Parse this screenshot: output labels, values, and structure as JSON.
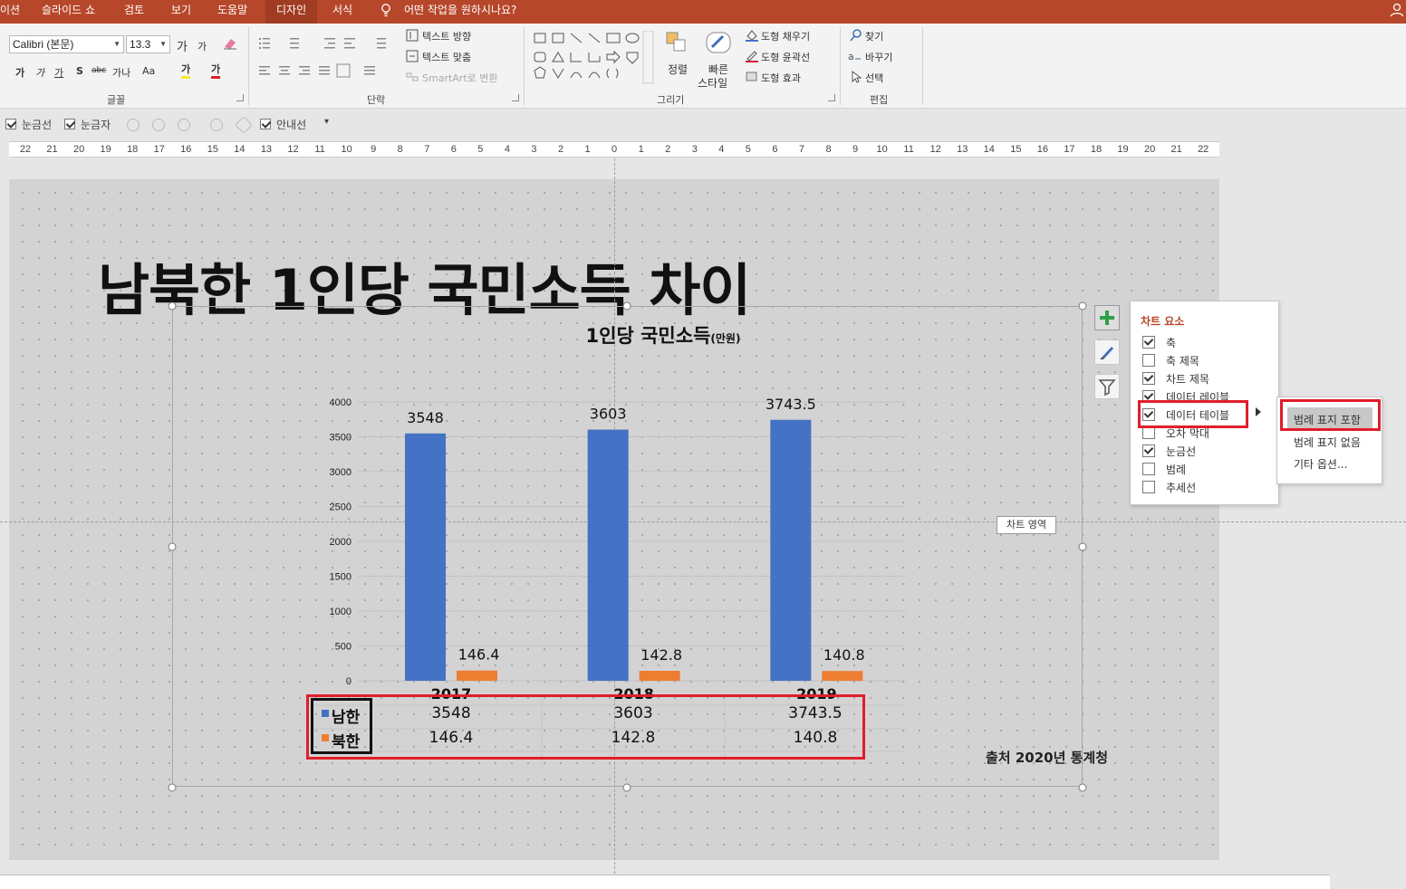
{
  "menu": {
    "tabs": [
      "이션",
      "슬라이드 쇼",
      "검토",
      "보기",
      "도움말",
      "디자인",
      "서식"
    ],
    "tell_me": "어떤 작업을 원하시나요?"
  },
  "ribbon": {
    "font": {
      "font_name": "Calibri (본문)",
      "font_size": "13.3",
      "grow_label": "가",
      "shrink_label": "가",
      "bold": "가",
      "italic": "가",
      "underline": "가",
      "shadow": "S",
      "strike": "abc",
      "spacing": "가나",
      "case": "Aa",
      "highlight": "가",
      "font_color": "가",
      "group_label": "글꼴"
    },
    "paragraph": {
      "text_direction": "텍스트 방향",
      "align_text": "텍스트 맞춤",
      "smartart": "SmartArt로 변환",
      "group_label": "단락"
    },
    "drawing": {
      "arrange": "정렬",
      "quick_styles_1": "빠른",
      "quick_styles_2": "스타일",
      "shape_fill": "도형 채우기",
      "shape_outline": "도형 윤곽선",
      "shape_effects": "도형 효과",
      "group_label": "그리기"
    },
    "editing": {
      "find": "찾기",
      "replace": "바꾸기",
      "select": "선택",
      "group_label": "편집"
    }
  },
  "viewbar": {
    "gridlines": "눈금선",
    "ruler": "눈금자",
    "guides": "안내선"
  },
  "ruler": {
    "labels": [
      "22",
      "21",
      "20",
      "19",
      "18",
      "17",
      "16",
      "15",
      "14",
      "13",
      "12",
      "11",
      "10",
      "9",
      "8",
      "7",
      "6",
      "5",
      "4",
      "3",
      "2",
      "1",
      "0",
      "1",
      "2",
      "3",
      "4",
      "5",
      "6",
      "7",
      "8",
      "9",
      "10",
      "11",
      "12",
      "13",
      "14",
      "15",
      "16",
      "17",
      "18",
      "19",
      "20",
      "21",
      "22"
    ]
  },
  "slide": {
    "title": "남북한 1인당 국민소득 차이",
    "source": "출처 2020년 통계청",
    "tooltip": "차트 영역"
  },
  "chart_data": {
    "type": "bar",
    "title": "1인당 국민소득",
    "title_unit": "(만원)",
    "categories": [
      "2017",
      "2018",
      "2019"
    ],
    "series": [
      {
        "name": "남한",
        "values": [
          3548,
          3603,
          3743.5
        ],
        "color": "#4472c4"
      },
      {
        "name": "북한",
        "values": [
          146.4,
          142.8,
          140.8
        ],
        "color": "#ed7d31"
      }
    ],
    "ylim": [
      0,
      4000
    ],
    "yticks": [
      0,
      500,
      1000,
      1500,
      2000,
      2500,
      3000,
      3500,
      4000
    ],
    "grid": true,
    "data_labels": true,
    "data_table": true,
    "legend": false
  },
  "chart_elements": {
    "title": "차트 요소",
    "items": [
      {
        "label": "축",
        "checked": true
      },
      {
        "label": "축 제목",
        "checked": false
      },
      {
        "label": "차트 제목",
        "checked": true
      },
      {
        "label": "데이터 레이블",
        "checked": true
      },
      {
        "label": "데이터 테이블",
        "checked": true
      },
      {
        "label": "오차 막대",
        "checked": false
      },
      {
        "label": "눈금선",
        "checked": true
      },
      {
        "label": "범례",
        "checked": false
      },
      {
        "label": "추세선",
        "checked": false
      }
    ]
  },
  "data_table_submenu": {
    "items": [
      "범례 표지 포함",
      "범례 표지 없음",
      "기타 옵션..."
    ]
  },
  "colors": {
    "accent": "#b7472a",
    "highlight_box": "#e11d2a",
    "south": "#4472c4",
    "north": "#ed7d31"
  }
}
